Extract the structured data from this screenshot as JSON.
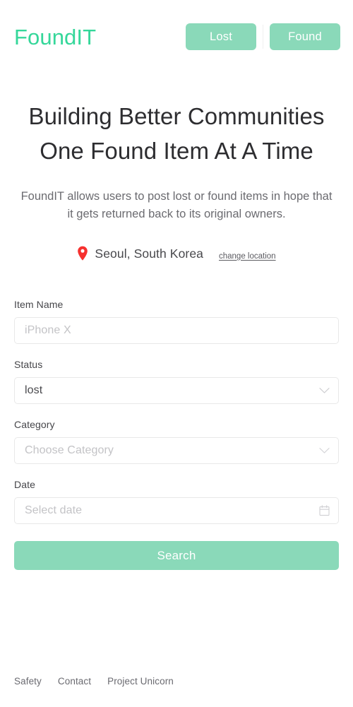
{
  "brand": {
    "logo_text": "FoundIT",
    "logo_color": "#35d79a",
    "accent_color": "#8ad79b",
    "pin_color": "#f6312f"
  },
  "header": {
    "nav": [
      {
        "label": "Lost",
        "name": "nav-lost-button"
      },
      {
        "label": "Found",
        "name": "nav-found-button"
      }
    ]
  },
  "hero": {
    "title": "Building Better Communities One Found Item At A Time",
    "subtitle": "FoundIT allows users to post lost or found items in hope that it gets returned back to its original owners."
  },
  "location": {
    "icon": "map-pin-icon",
    "name": "Seoul, South Korea",
    "change_link": "change location"
  },
  "form": {
    "item_name": {
      "label": "Item Name",
      "placeholder": "iPhone X",
      "value": ""
    },
    "status": {
      "label": "Status",
      "value": "lost",
      "placeholder": "",
      "icon": "chevron-down-icon"
    },
    "category": {
      "label": "Category",
      "value": "",
      "placeholder": "Choose Category",
      "icon": "chevron-down-icon"
    },
    "date": {
      "label": "Date",
      "value": "",
      "placeholder": "Select date",
      "icon": "calendar-icon"
    },
    "submit_label": "Search"
  },
  "footer": {
    "links": [
      {
        "label": "Safety",
        "name": "footer-link-safety"
      },
      {
        "label": "Contact",
        "name": "footer-link-contact"
      },
      {
        "label": "Project Unicorn",
        "name": "footer-link-project-unicorn"
      }
    ]
  }
}
